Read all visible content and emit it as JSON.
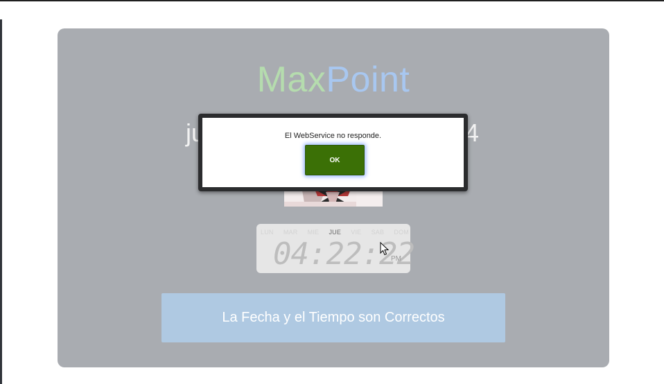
{
  "brand": {
    "part1": "MaxPoint",
    "part1_a": "Max",
    "part1_b": "Point",
    "color_max": "#b5dcae",
    "color_point": "#a8c7f0"
  },
  "date": {
    "prefix": "ju",
    "suffix": "4"
  },
  "clock": {
    "days": [
      "LUN",
      "MAR",
      "MIE",
      "JUE",
      "VIE",
      "SAB",
      "DOM"
    ],
    "active_day": "JUE",
    "time": "04:22:22",
    "ampm": "PM"
  },
  "confirm": {
    "label": "La Fecha y el Tiempo son Correctos",
    "color": "#afc9e2"
  },
  "dialog": {
    "message": "El WebService no responde.",
    "ok_label": "OK",
    "ok_color": "#3b7006"
  },
  "icons": {
    "cursor": "mouse-pointer-icon"
  }
}
